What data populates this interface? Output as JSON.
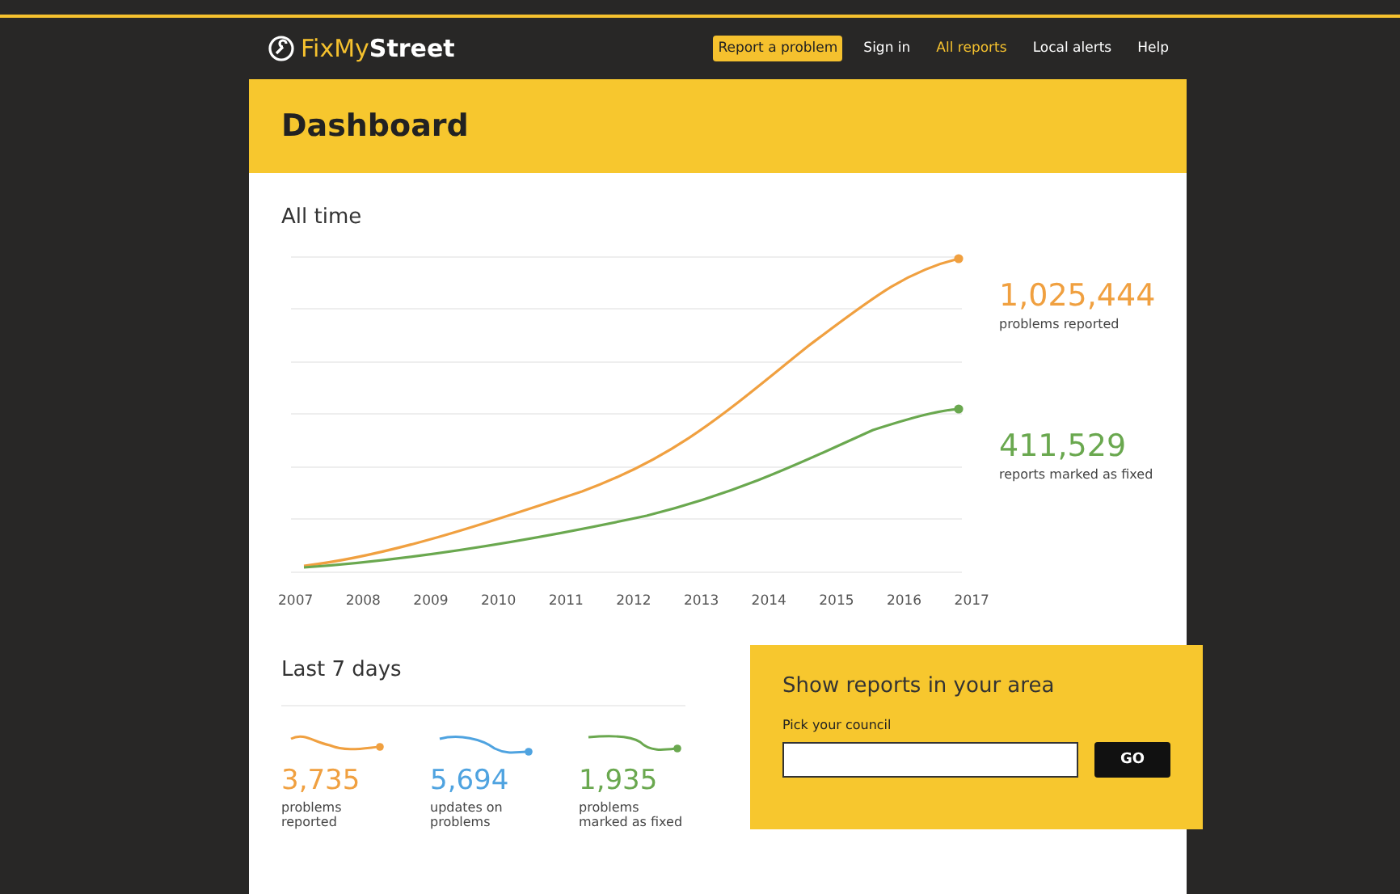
{
  "header": {
    "logo": "FixMy**Street**",
    "nav": [
      {
        "label": "Report a problem",
        "kind": "cta",
        "selected": false
      },
      {
        "label": "Sign in",
        "kind": "plain",
        "selected": false
      },
      {
        "label": "All reports",
        "kind": "plain",
        "selected": true
      },
      {
        "label": "Local alerts",
        "kind": "plain",
        "selected": false
      },
      {
        "label": "Help",
        "kind": "plain",
        "selected": false
      }
    ]
  },
  "page": {
    "title": "Dashboard"
  },
  "all_time": {
    "heading": "All time",
    "x_labels": [
      "2007",
      "2008",
      "2009",
      "2010",
      "2011",
      "2012",
      "2013",
      "2014",
      "2015",
      "2016",
      "2017"
    ],
    "series": [
      {
        "value": "1,025,444",
        "label": "problems reported",
        "color": "#f0a040"
      },
      {
        "value": "411,529",
        "label": "reports marked as fixed",
        "color": "#6aa84f"
      }
    ]
  },
  "last_7_days": {
    "heading": "Last 7 days",
    "stats": [
      {
        "value": "3,735",
        "label": "problems reported",
        "color": "#f0a040"
      },
      {
        "value": "5,694",
        "label": "updates on problems",
        "color": "#4fa3e0"
      },
      {
        "value": "1,935",
        "label": "problems marked as fixed",
        "color": "#6aa84f"
      }
    ]
  },
  "area_search": {
    "title": "Show reports in your area",
    "field_label": "Pick your council",
    "button": "GO"
  }
}
